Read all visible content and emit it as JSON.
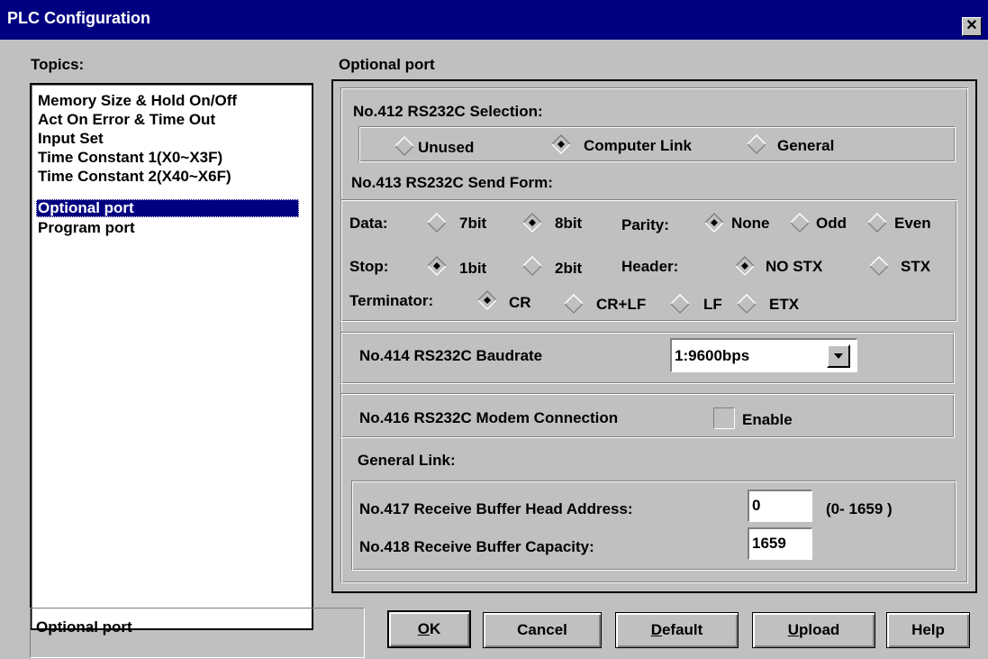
{
  "window": {
    "title": "PLC Configuration",
    "close_glyph": "✕"
  },
  "topics": {
    "label": "Topics:",
    "items": [
      "Memory Size & Hold On/Off",
      "Act On Error & Time Out",
      "Input Set",
      "Time Constant 1(X0~X3F)",
      "Time Constant 2(X40~X6F)",
      "Optional port",
      "Program port"
    ],
    "selected": "Optional port"
  },
  "section_title": "Optional port",
  "rs232c_selection": {
    "label": "No.412 RS232C Selection:",
    "options": [
      "Unused",
      "Computer Link",
      "General"
    ],
    "selected": "Computer Link"
  },
  "send_form": {
    "label": "No.413 RS232C Send Form:",
    "data_label": "Data:",
    "data_options": [
      "7bit",
      "8bit"
    ],
    "data_selected": "8bit",
    "parity_label": "Parity:",
    "parity_options": [
      "None",
      "Odd",
      "Even"
    ],
    "parity_selected": "None",
    "stop_label": "Stop:",
    "stop_options": [
      "1bit",
      "2bit"
    ],
    "stop_selected": "1bit",
    "header_label": "Header:",
    "header_options": [
      "NO STX",
      "STX"
    ],
    "header_selected": "NO STX",
    "terminator_label": "Terminator:",
    "terminator_options": [
      "CR",
      "CR+LF",
      "LF",
      "ETX"
    ],
    "terminator_selected": "CR"
  },
  "baudrate": {
    "label": "No.414 RS232C Baudrate",
    "value": "1:9600bps"
  },
  "modem": {
    "label": "No.416 RS232C Modem Connection",
    "checkbox_label": "Enable",
    "checked": false
  },
  "general_link": {
    "label": "General Link:",
    "head_address_label": "No.417 Receive Buffer Head Address:",
    "head_address_value": "0",
    "head_address_range": "(0- 1659 )",
    "capacity_label": "No.418 Receive Buffer Capacity:",
    "capacity_value": "1659"
  },
  "status_text": "Optional port",
  "buttons": {
    "ok": {
      "mnemonic": "O",
      "rest": "K"
    },
    "cancel": "Cancel",
    "default": {
      "mnemonic": "D",
      "rest": "efault"
    },
    "upload": {
      "mnemonic": "U",
      "rest": "pload"
    },
    "help": "Help"
  }
}
